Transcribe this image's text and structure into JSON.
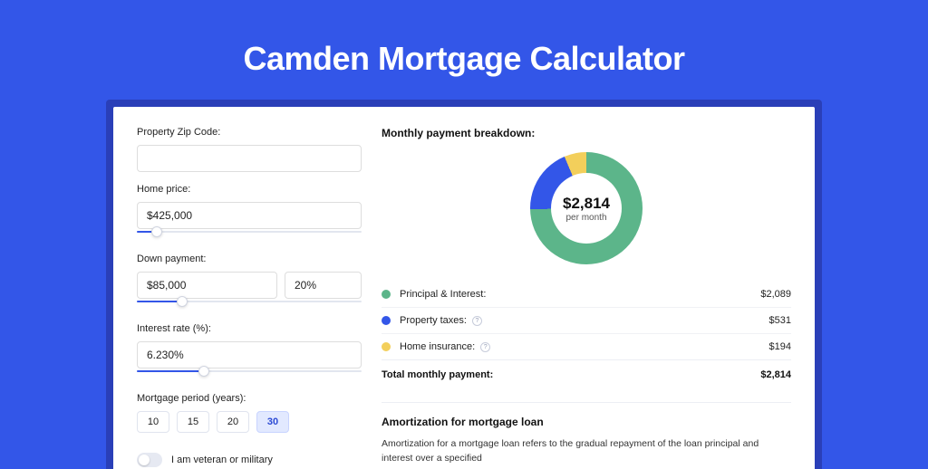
{
  "header": {
    "title": "Camden Mortgage Calculator"
  },
  "form": {
    "zip": {
      "label": "Property Zip Code:",
      "value": ""
    },
    "home_price": {
      "label": "Home price:",
      "value": "$425,000",
      "slider_pct": 9
    },
    "down_payment": {
      "label": "Down payment:",
      "amount": "$85,000",
      "pct": "20%",
      "slider_pct": 20
    },
    "interest": {
      "label": "Interest rate (%):",
      "value": "6.230%",
      "slider_pct": 30
    },
    "period": {
      "label": "Mortgage period (years):",
      "options": [
        "10",
        "15",
        "20",
        "30"
      ],
      "selected": "30"
    },
    "veteran": {
      "label": "I am veteran or military",
      "checked": false
    }
  },
  "breakdown": {
    "title": "Monthly payment breakdown:",
    "center_value": "$2,814",
    "center_sub": "per month",
    "rows": [
      {
        "color": "#5cb58a",
        "name": "Principal & Interest:",
        "value": "$2,089",
        "info": false
      },
      {
        "color": "#3356e8",
        "name": "Property taxes:",
        "value": "$531",
        "info": true
      },
      {
        "color": "#f3cf5b",
        "name": "Home insurance:",
        "value": "$194",
        "info": true
      }
    ],
    "total_label": "Total monthly payment:",
    "total_value": "$2,814"
  },
  "amortization": {
    "title": "Amortization for mortgage loan",
    "text": "Amortization for a mortgage loan refers to the gradual repayment of the loan principal and interest over a specified"
  },
  "chart_data": {
    "type": "pie",
    "title": "Monthly payment breakdown",
    "series": [
      {
        "name": "Principal & Interest",
        "value": 2089,
        "color": "#5cb58a"
      },
      {
        "name": "Property taxes",
        "value": 531,
        "color": "#3356e8"
      },
      {
        "name": "Home insurance",
        "value": 194,
        "color": "#f3cf5b"
      }
    ],
    "total": 2814,
    "center_label": "$2,814 per month"
  }
}
